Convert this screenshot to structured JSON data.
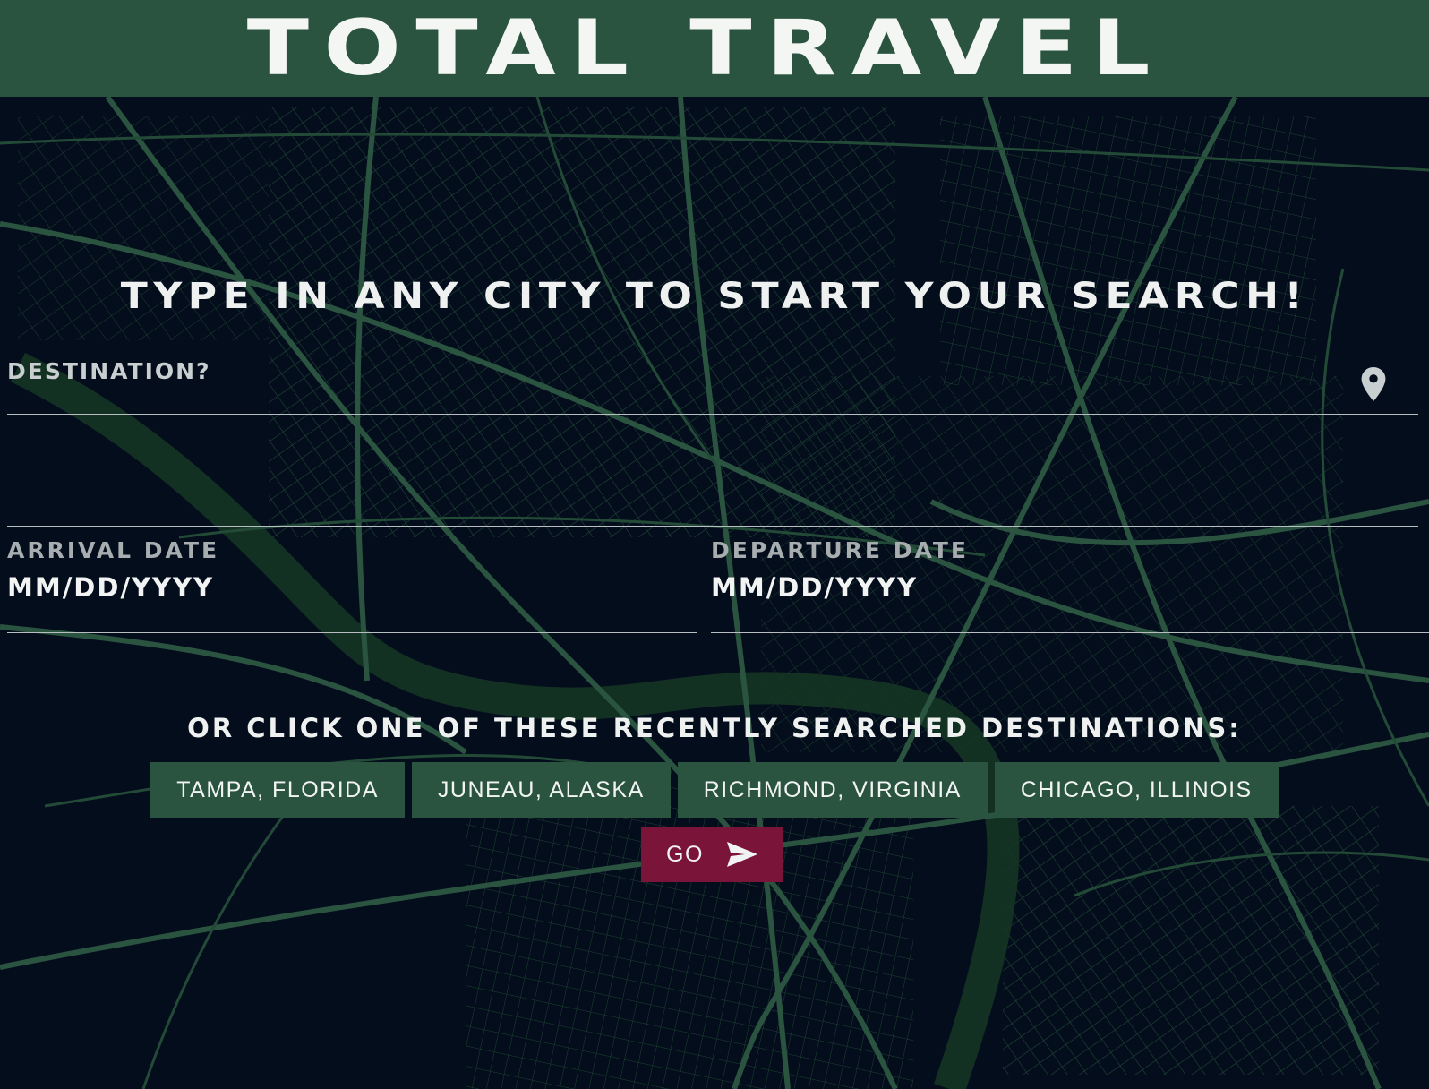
{
  "header": {
    "title": "TOTAL TRAVEL"
  },
  "search": {
    "prompt": "TYPE IN ANY CITY TO START YOUR SEARCH!",
    "destination_label": "DESTINATION?",
    "destination_icon": "map-pin-icon"
  },
  "dates": {
    "arrival_label": "ARRIVAL DATE",
    "arrival_placeholder": "MM/DD/YYYY",
    "departure_label": "DEPARTURE DATE",
    "departure_placeholder": "MM/DD/YYYY"
  },
  "recent": {
    "heading": "OR CLICK ONE OF THESE RECENTLY SEARCHED DESTINATIONS:",
    "destinations": [
      "TAMPA, FLORIDA",
      "JUNEAU, ALASKA",
      "RICHMOND, VIRGINIA",
      "CHICAGO, ILLINOIS"
    ]
  },
  "go_button": {
    "label": "GO",
    "icon": "send-icon"
  },
  "colors": {
    "header_bg": "#2a5440",
    "page_bg": "#040d1c",
    "map_streets": "#2a5440",
    "button_bg": "#2a5440",
    "go_bg": "#7a1438",
    "text": "#eef1ef"
  }
}
